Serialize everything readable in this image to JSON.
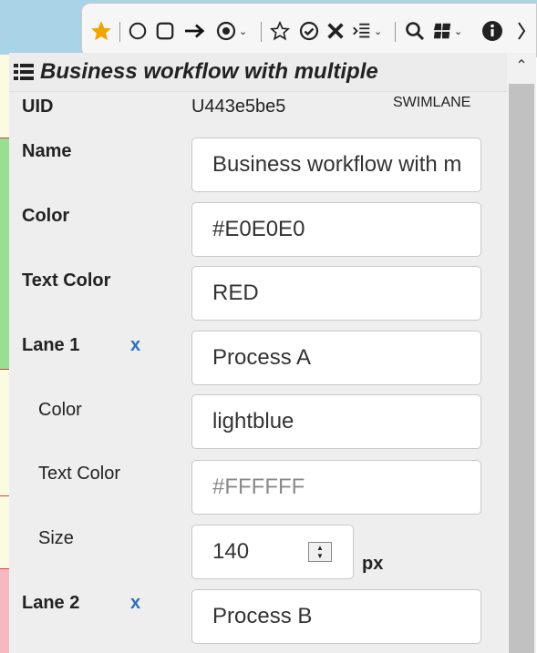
{
  "toolbar": {
    "icons": [
      "star-icon",
      "circle-icon",
      "square-icon",
      "arrow-right-icon",
      "target-icon",
      "star-outline-icon",
      "check-circle-icon",
      "x-icon",
      "list-indent-icon",
      "search-icon",
      "grid-icon",
      "info-icon",
      "chevron-right-icon"
    ],
    "accent_color": "#f0a500"
  },
  "panel": {
    "title": "Business workflow with multiple",
    "uid_label": "UID",
    "uid_value": "U443e5be5",
    "type_label": "SWIMLANE",
    "name_label": "Name",
    "name_value": "Business workflow with multiple",
    "color_label": "Color",
    "color_value": "#E0E0E0",
    "text_color_label": "Text Color",
    "text_color_value": "RED",
    "lane1": {
      "label": "Lane 1",
      "remove": "x",
      "name_value": "Process A",
      "color_label": "Color",
      "color_value": "lightblue",
      "text_color_label": "Text Color",
      "text_color_placeholder": "#FFFFFF",
      "size_label": "Size",
      "size_value": "140",
      "size_unit": "px"
    },
    "lane2": {
      "label": "Lane 2",
      "remove": "x",
      "name_value": "Process B"
    }
  }
}
